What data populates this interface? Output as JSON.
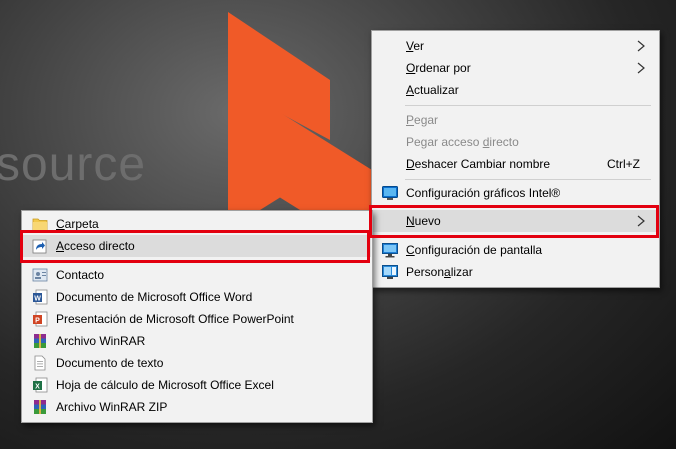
{
  "wallpaper": {
    "brand_text": "source",
    "accent": "#f05a28"
  },
  "context_menu": {
    "items": [
      {
        "access": "V",
        "rest": "er",
        "submenu": true
      },
      {
        "access": "O",
        "rest": "rdenar por",
        "submenu": true
      },
      {
        "access": "A",
        "rest": "ctualizar"
      },
      {
        "access": "P",
        "rest": "egar",
        "disabled": true
      },
      {
        "pre": "Pegar acceso ",
        "access": "d",
        "rest": "irecto",
        "disabled": true
      },
      {
        "access": "D",
        "rest": "eshacer Cambiar nombre",
        "shortcut": "Ctrl+Z"
      },
      {
        "label": "Configuración gráficos Intel®",
        "icon": "intel-graphics-icon"
      },
      {
        "access": "N",
        "rest": "uevo",
        "submenu": true,
        "highlighted": true
      },
      {
        "access": "C",
        "rest": "onfiguración de pantalla",
        "icon": "display-settings-icon"
      },
      {
        "pre": "Person",
        "access": "a",
        "rest": "lizar",
        "icon": "personalize-icon"
      }
    ]
  },
  "new_submenu": {
    "items": [
      {
        "access": "C",
        "rest": "arpeta",
        "icon": "folder-icon"
      },
      {
        "access": "A",
        "rest": "cceso directo",
        "icon": "shortcut-icon",
        "highlighted": true
      },
      {
        "label": "Contacto",
        "icon": "contact-icon"
      },
      {
        "label": "Documento de Microsoft Office Word",
        "icon": "word-document-icon"
      },
      {
        "label": "Presentación de Microsoft Office PowerPoint",
        "icon": "powerpoint-icon"
      },
      {
        "label": "Archivo WinRAR",
        "icon": "winrar-icon"
      },
      {
        "label": "Documento de texto",
        "icon": "text-document-icon"
      },
      {
        "label": "Hoja de cálculo de Microsoft Office Excel",
        "icon": "excel-icon"
      },
      {
        "label": "Archivo WinRAR ZIP",
        "icon": "winrar-zip-icon"
      }
    ]
  },
  "highlight_color": "#e3000f"
}
